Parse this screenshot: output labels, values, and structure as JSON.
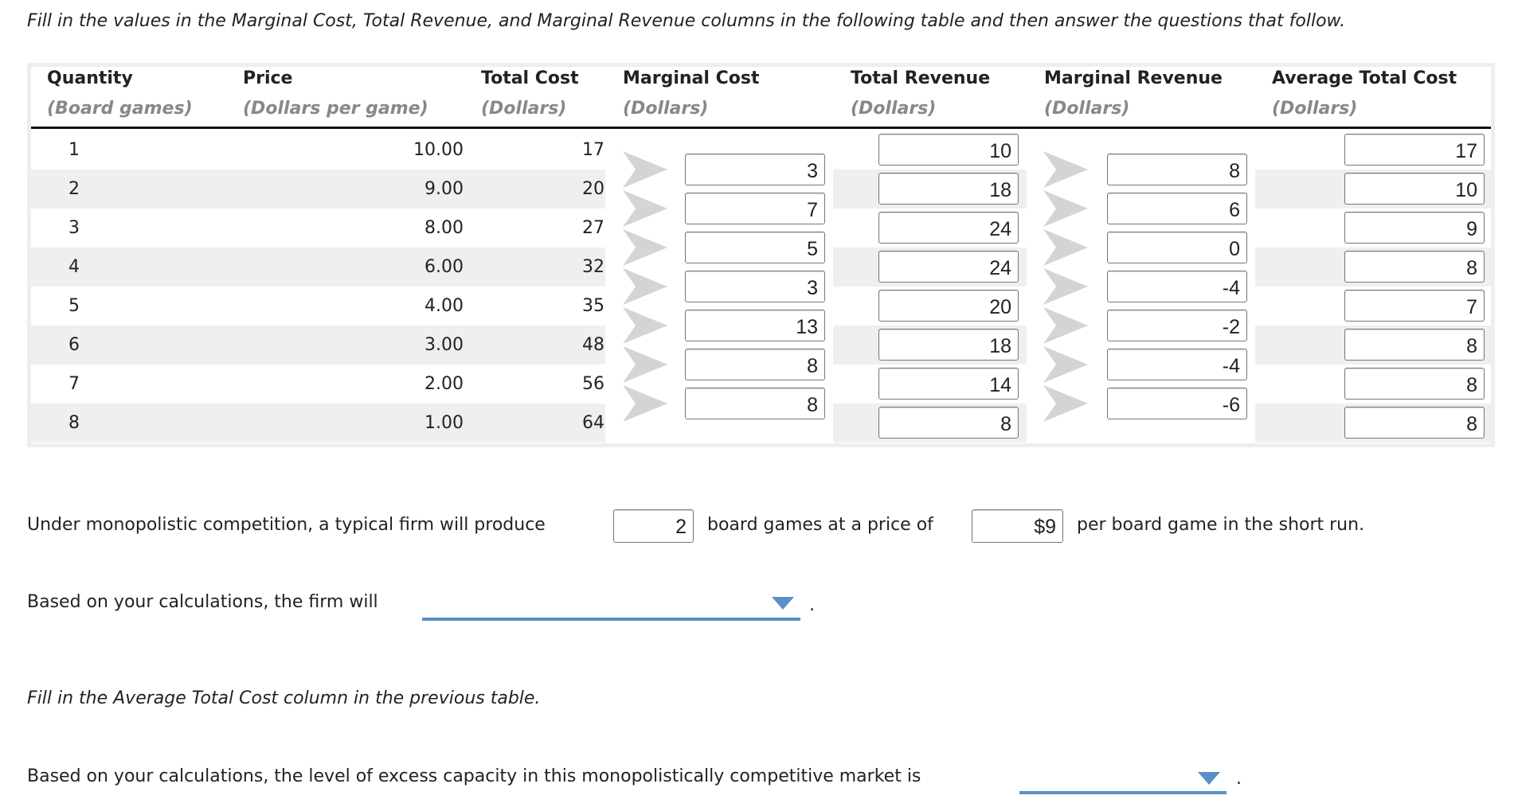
{
  "instruction": "Fill in the values in the Marginal Cost, Total Revenue, and Marginal Revenue columns in the following table and then answer the questions that follow.",
  "table": {
    "headers": [
      {
        "title": "Quantity",
        "unit": "(Board games)"
      },
      {
        "title": "Price",
        "unit": "(Dollars per game)"
      },
      {
        "title": "Total Cost",
        "unit": "(Dollars)"
      },
      {
        "title": "Marginal Cost",
        "unit": "(Dollars)"
      },
      {
        "title": "Total Revenue",
        "unit": "(Dollars)"
      },
      {
        "title": "Marginal Revenue",
        "unit": "(Dollars)"
      },
      {
        "title": "Average Total Cost",
        "unit": "(Dollars)"
      }
    ],
    "quantity": [
      "1",
      "2",
      "3",
      "4",
      "5",
      "6",
      "7",
      "8"
    ],
    "price": [
      "10.00",
      "9.00",
      "8.00",
      "6.00",
      "4.00",
      "3.00",
      "2.00",
      "1.00"
    ],
    "total_cost": [
      "17",
      "20",
      "27",
      "32",
      "35",
      "48",
      "56",
      "64"
    ],
    "marginal_cost": [
      "3",
      "7",
      "5",
      "3",
      "13",
      "8",
      "8"
    ],
    "total_revenue": [
      "10",
      "18",
      "24",
      "24",
      "20",
      "18",
      "14",
      "8"
    ],
    "marginal_revenue": [
      "8",
      "6",
      "0",
      "-4",
      "-2",
      "-4",
      "-6"
    ],
    "average_total_cost": [
      "17",
      "10",
      "9",
      "8",
      "7",
      "8",
      "8",
      "8"
    ]
  },
  "q1": {
    "text_before": "Under monopolistic competition, a typical firm will produce",
    "quantity_value": "2",
    "text_middle": "board games at a price of",
    "price_value": "$9",
    "text_after": "per board game in the short run."
  },
  "q2": {
    "text_before": "Based on your calculations, the firm will",
    "selected": "",
    "text_after": "."
  },
  "q3": {
    "text": "Fill in the Average Total Cost column in the previous table."
  },
  "q4": {
    "text_before": "Based on your calculations, the level of excess capacity in this monopolistically competitive market is",
    "selected": "",
    "text_after": "."
  },
  "colors": {
    "dropdown_accent": "#5b8fc7",
    "row_stripe": "#efefef",
    "arrow": "#d4d4d4"
  }
}
